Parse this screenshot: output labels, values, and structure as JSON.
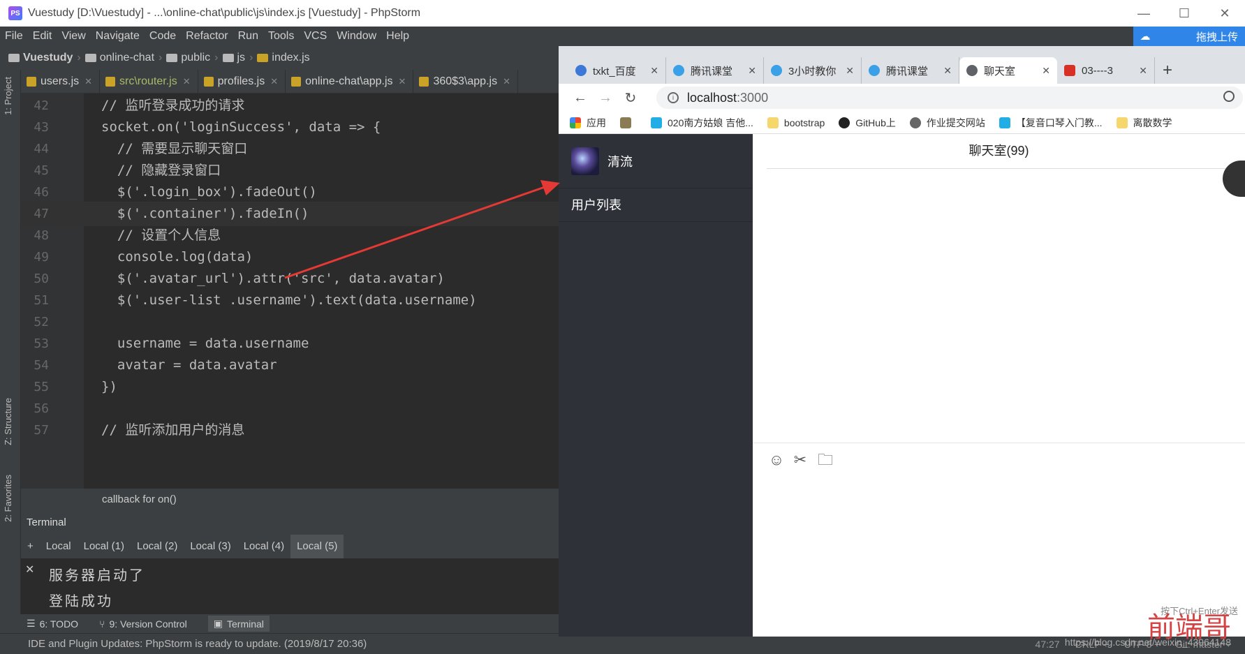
{
  "window": {
    "title": "Vuestudy [D:\\Vuestudy] - ...\\online-chat\\public\\js\\index.js [Vuestudy] - PhpStorm",
    "controls": [
      "—",
      "☐",
      "✕"
    ]
  },
  "menu": [
    "File",
    "Edit",
    "View",
    "Navigate",
    "Code",
    "Refactor",
    "Run",
    "Tools",
    "VCS",
    "Window",
    "Help"
  ],
  "upload_button": "拖拽上传",
  "breadcrumb": [
    "Vuestudy",
    "online-chat",
    "public",
    "js",
    "index.js"
  ],
  "editor_tabs": [
    "users.js",
    "src\\router.js",
    "profiles.js",
    "online-chat\\app.js",
    "360$3\\app.js"
  ],
  "side_labels": {
    "project": "1: Project",
    "structure": "Z: Structure",
    "favorites": "2: Favorites"
  },
  "code": [
    {
      "n": "42",
      "t": "// 监听登录成功的请求"
    },
    {
      "n": "43",
      "t": "socket.on('loginSuccess', data => {"
    },
    {
      "n": "44",
      "t": "  // 需要显示聊天窗口"
    },
    {
      "n": "45",
      "t": "  // 隐藏登录窗口"
    },
    {
      "n": "46",
      "t": "  $('.login_box').fadeOut()"
    },
    {
      "n": "47",
      "t": "  $('.container').fadeIn()"
    },
    {
      "n": "48",
      "t": "  // 设置个人信息"
    },
    {
      "n": "49",
      "t": "  console.log(data)"
    },
    {
      "n": "50",
      "t": "  $('.avatar_url').attr('src', data.avatar)"
    },
    {
      "n": "51",
      "t": "  $('.user-list .username').text(data.username)"
    },
    {
      "n": "52",
      "t": ""
    },
    {
      "n": "53",
      "t": "  username = data.username"
    },
    {
      "n": "54",
      "t": "  avatar = data.avatar"
    },
    {
      "n": "55",
      "t": "})"
    },
    {
      "n": "56",
      "t": ""
    },
    {
      "n": "57",
      "t": "// 监听添加用户的消息"
    }
  ],
  "hint": "callback for on()",
  "terminal": {
    "title": "Terminal",
    "add": "+",
    "close": "✕",
    "tabs": [
      "Local",
      "Local (1)",
      "Local (2)",
      "Local (3)",
      "Local (4)",
      "Local (5)"
    ],
    "lines": [
      "服务器启动了",
      "登陆成功"
    ]
  },
  "toolwindows": [
    "6: TODO",
    "9: Version Control",
    "Terminal"
  ],
  "status": {
    "message": "IDE and Plugin Updates: PhpStorm is ready to update. (2019/8/17 20:36)",
    "position": "47:27",
    "line_sep": "CRLF ÷",
    "encoding": "UTF-8 ÷",
    "vcs": "Git: master ÷"
  },
  "browser": {
    "tabs": [
      {
        "title": "txkt_百度",
        "icon_color": "#3c78d8"
      },
      {
        "title": "腾讯课堂",
        "icon_color": "#3aa0e8"
      },
      {
        "title": "3小时教你",
        "icon_color": "#3aa0e8"
      },
      {
        "title": "腾讯课堂",
        "icon_color": "#3aa0e8"
      },
      {
        "title": "聊天室",
        "icon_color": "#5f6368"
      },
      {
        "title": "03----3",
        "icon_color": "#d93025"
      }
    ],
    "url_host": "localhost",
    "url_port": ":3000",
    "bookmarks": [
      "应用",
      "",
      "020南方姑娘 吉他...",
      "bootstrap",
      "GitHub上",
      "作业提交网站",
      "【复音口琴入门教...",
      "离散数学"
    ]
  },
  "chat": {
    "username": "清流",
    "userlist_title": "用户列表",
    "room_title": "聊天室(99)",
    "send_hint": "按下Ctrl+Enter发送"
  },
  "watermark": "前端哥",
  "url_watermark": "https://blog.csdn.net/weixin_43964148",
  "colors": {
    "ide_bg": "#2b2b2b",
    "chat_sidebar": "#2e3238",
    "arrow": "#e53935",
    "accent": "#2f86e8"
  }
}
